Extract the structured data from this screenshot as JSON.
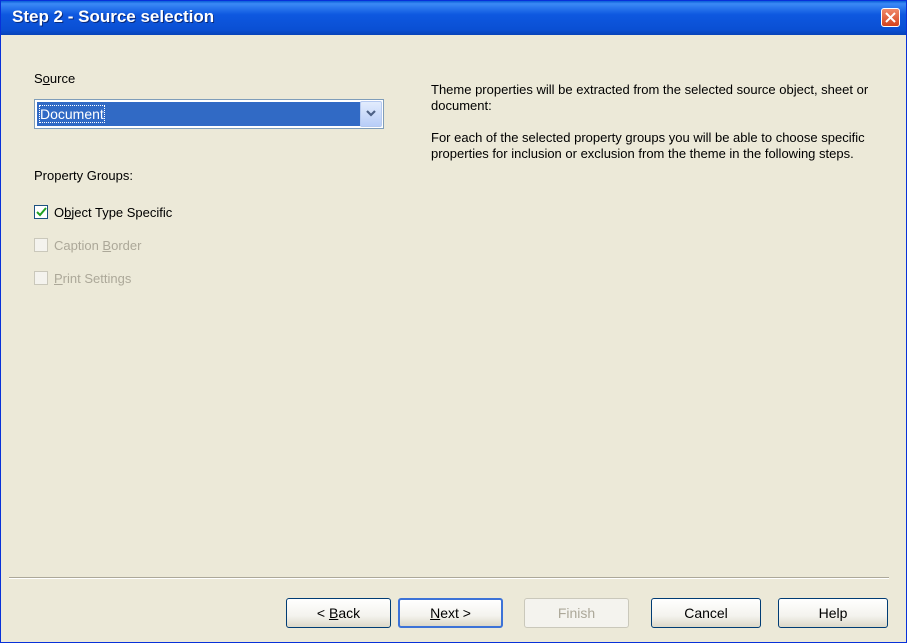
{
  "window": {
    "title": "Step 2 - Source selection",
    "close_icon": "close-x-icon"
  },
  "source": {
    "label_pre": "S",
    "label_accel": "o",
    "label_post": "urce",
    "selected": "Document",
    "dropdown_icon": "chevron-down-icon"
  },
  "property_groups": {
    "heading": "Property Groups:",
    "items": [
      {
        "pre": "O",
        "accel": "b",
        "post": "ject Type Specific",
        "checked": true,
        "enabled": true
      },
      {
        "pre": "Caption ",
        "accel": "B",
        "post": "order",
        "checked": false,
        "enabled": false
      },
      {
        "pre": "",
        "accel": "P",
        "post": "rint Settings",
        "checked": false,
        "enabled": false
      }
    ]
  },
  "info": {
    "paragraph1": "Theme properties will be extracted from the selected source object, sheet or document:",
    "paragraph2": "For each of the selected property groups you will be able to choose specific properties for inclusion or exclusion from the theme in the following steps."
  },
  "buttons": {
    "back": {
      "pre": "< ",
      "accel": "B",
      "post": "ack"
    },
    "next": {
      "pre": "",
      "accel": "N",
      "post": "ext >"
    },
    "finish": "Finish",
    "cancel": "Cancel",
    "help": "Help"
  },
  "colors": {
    "titlebar": "#0a4fd3",
    "dialog_bg": "#ece9d8",
    "selection": "#316ac5",
    "check": "#21a121"
  }
}
